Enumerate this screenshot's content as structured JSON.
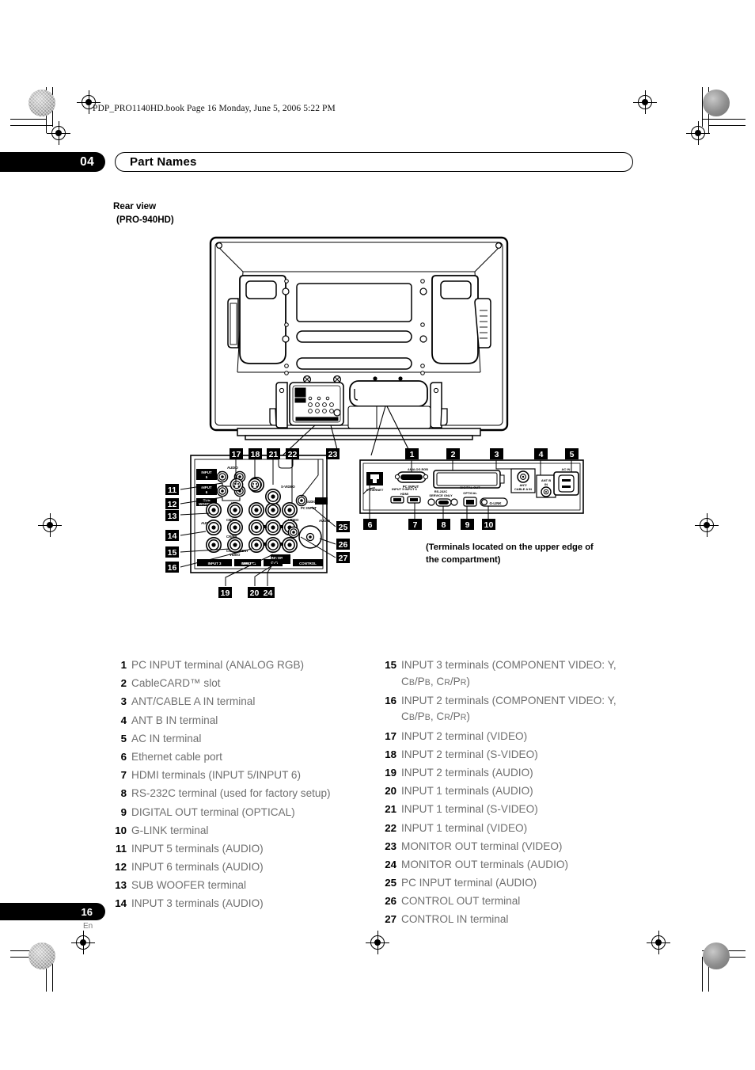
{
  "file_header": "PDP_PRO1140HD.book  Page 16  Monday, June 5, 2006  5:22 PM",
  "chapter": {
    "number": "04",
    "title": "Part Names"
  },
  "figure": {
    "caption_line1": "Rear view",
    "caption_line2": "(PRO-940HD)",
    "note": "(Terminals located on the upper edge of the compartment)",
    "upper_panel_labels": [
      "ANALOG RGB",
      "PC INPUT",
      "CableCARD",
      "ANT/CABLE A IN",
      "ANT B IN",
      "AC IN",
      "ETHERNET",
      "INPUT 5",
      "INPUT 6",
      "HDMI",
      "RS-232C",
      "DIGITAL OUT",
      "OPTICAL",
      "G-LINK"
    ],
    "lower_panel_labels": [
      "INPUT 5",
      "INPUT 6",
      "SUB WOOFER",
      "AUDIO",
      "COMPONENT VIDEO",
      "VIDEO",
      "S-VIDEO",
      "PC INPUT",
      "INPUT 3",
      "INPUT 2",
      "INPUT 1",
      "MONITOR OUT",
      "CONTROL",
      "IN",
      "OUT",
      "Y",
      "CB/PB",
      "CR/PR",
      "L",
      "R"
    ],
    "callouts_upper": [
      "1",
      "2",
      "3",
      "4",
      "5",
      "6",
      "7",
      "8",
      "9",
      "10"
    ],
    "callouts_lower_top": [
      "17",
      "18",
      "21",
      "22",
      "23"
    ],
    "callouts_lower_left": [
      "11",
      "12",
      "13",
      "14",
      "15",
      "16"
    ],
    "callouts_lower_bottom": [
      "19",
      "20",
      "24"
    ],
    "callouts_lower_right": [
      "25",
      "26",
      "27"
    ]
  },
  "references": {
    "left": [
      {
        "num": "1",
        "text": "PC INPUT terminal (ANALOG RGB)"
      },
      {
        "num": "2",
        "text": "CableCARD™ slot"
      },
      {
        "num": "3",
        "text": "ANT/CABLE A IN terminal"
      },
      {
        "num": "4",
        "text": "ANT B IN terminal"
      },
      {
        "num": "5",
        "text": "AC IN terminal"
      },
      {
        "num": "6",
        "text": "Ethernet cable port"
      },
      {
        "num": "7",
        "text": "HDMI terminals (INPUT 5/INPUT 6)"
      },
      {
        "num": "8",
        "text": "RS-232C terminal (used for factory setup)"
      },
      {
        "num": "9",
        "text": "DIGITAL OUT terminal (OPTICAL)"
      },
      {
        "num": "10",
        "text": "G-LINK terminal"
      },
      {
        "num": "11",
        "text": "INPUT 5 terminals (AUDIO)"
      },
      {
        "num": "12",
        "text": "INPUT 6 terminals (AUDIO)"
      },
      {
        "num": "13",
        "text": "SUB WOOFER terminal"
      },
      {
        "num": "14",
        "text": "INPUT 3 terminals (AUDIO)"
      }
    ],
    "right": [
      {
        "num": "15",
        "html": "INPUT 3 terminals (COMPONENT VIDEO: Y, C<sub>B</sub>/P<sub>B</sub>, C<sub>R</sub>/P<sub>R</sub>)"
      },
      {
        "num": "16",
        "html": "INPUT 2 terminals (COMPONENT VIDEO: Y, C<sub>B</sub>/P<sub>B</sub>, C<sub>R</sub>/P<sub>R</sub>)"
      },
      {
        "num": "17",
        "html": "INPUT 2 terminal (VIDEO)"
      },
      {
        "num": "18",
        "html": "INPUT 2 terminal (S-VIDEO)"
      },
      {
        "num": "19",
        "html": "INPUT 2 terminals (AUDIO)"
      },
      {
        "num": "20",
        "html": "INPUT 1 terminals (AUDIO)"
      },
      {
        "num": "21",
        "html": "INPUT 1 terminal (S-VIDEO)"
      },
      {
        "num": "22",
        "html": "INPUT 1 terminal (VIDEO)"
      },
      {
        "num": "23",
        "html": "MONITOR OUT terminal (VIDEO)"
      },
      {
        "num": "24",
        "html": "MONITOR OUT terminals (AUDIO)"
      },
      {
        "num": "25",
        "html": "PC INPUT terminal (AUDIO)"
      },
      {
        "num": "26",
        "html": "CONTROL OUT terminal"
      },
      {
        "num": "27",
        "html": "CONTROL IN terminal"
      }
    ]
  },
  "footer": {
    "page": "16",
    "language": "En"
  },
  "colors": {
    "ink": "#000000",
    "body_text": "#6f6f6f",
    "paper": "#ffffff"
  }
}
